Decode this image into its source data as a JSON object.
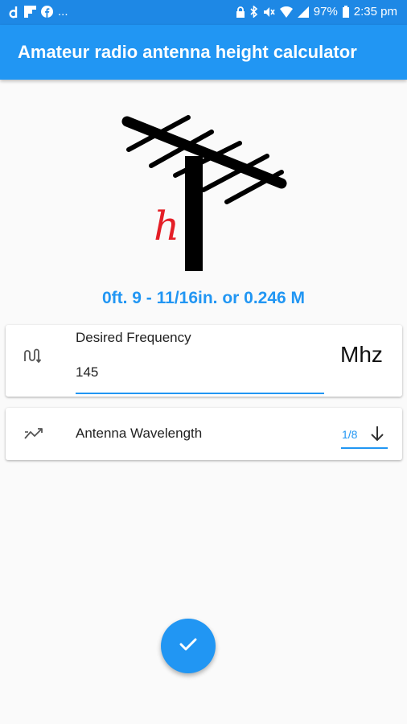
{
  "status_bar": {
    "battery_percent": "97%",
    "time": "2:35 pm",
    "notification_overflow": "..."
  },
  "app_bar": {
    "title": "Amateur radio antenna height calculator"
  },
  "illustration": {
    "height_symbol": "h",
    "symbol_color": "#e41e26"
  },
  "result": {
    "text": "0ft. 9 - 11/16in. or 0.246 M"
  },
  "frequency": {
    "label": "Desired Frequency",
    "value": "145",
    "unit": "Mhz"
  },
  "wavelength": {
    "label": "Antenna Wavelength",
    "selected": "1/8"
  },
  "icons": {
    "frequency": "signal-wave-icon",
    "wavelength": "trending-icon",
    "submit": "check-icon",
    "dropdown": "arrow-down-icon"
  },
  "colors": {
    "primary": "#2196f3",
    "status_bar": "#1e88e5",
    "background": "#fafafa"
  }
}
